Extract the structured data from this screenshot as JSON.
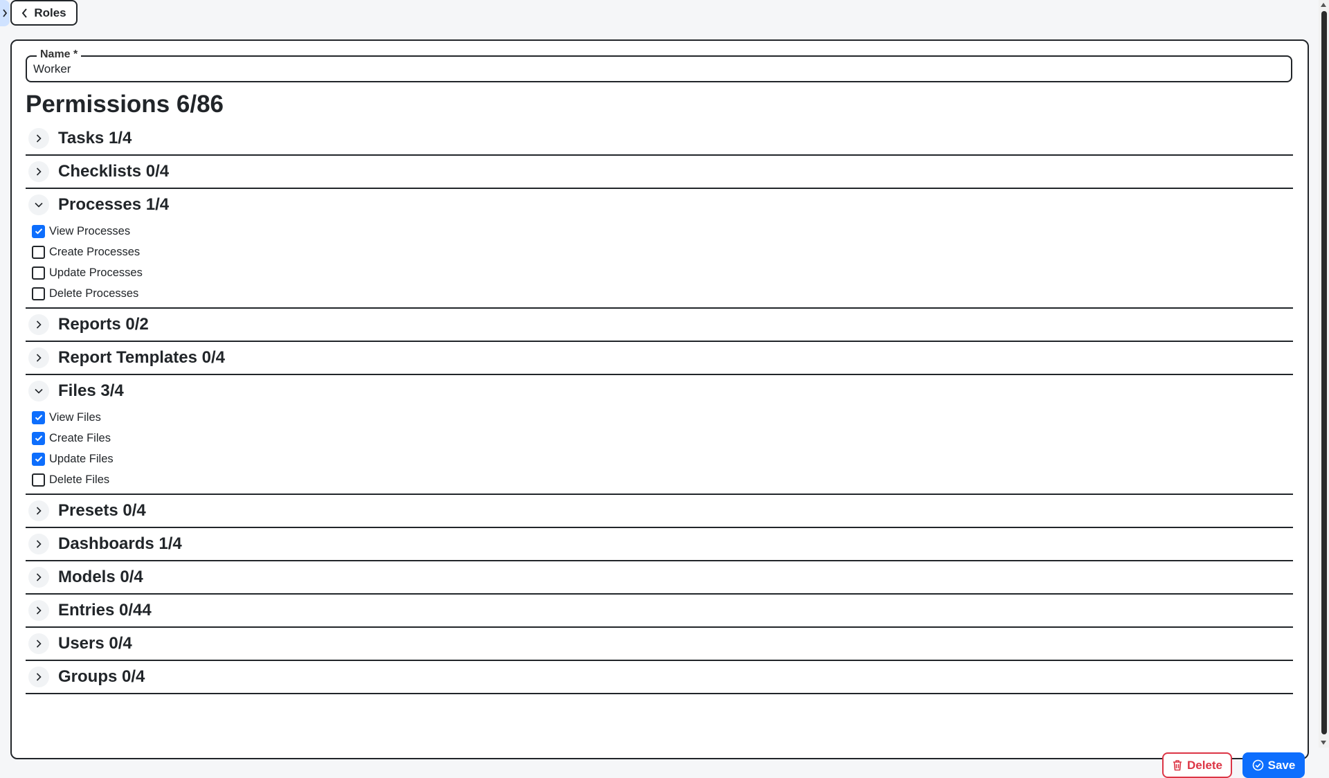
{
  "nav": {
    "back_label": "Roles"
  },
  "name_field": {
    "label": "Name *",
    "value": "Worker"
  },
  "permissions": {
    "title": "Permissions 6/86",
    "sections": [
      {
        "title": "Tasks 1/4",
        "expanded": false,
        "items": []
      },
      {
        "title": "Checklists 0/4",
        "expanded": false,
        "items": []
      },
      {
        "title": "Processes 1/4",
        "expanded": true,
        "items": [
          {
            "label": "View Processes",
            "checked": true
          },
          {
            "label": "Create Processes",
            "checked": false
          },
          {
            "label": "Update Processes",
            "checked": false
          },
          {
            "label": "Delete Processes",
            "checked": false
          }
        ]
      },
      {
        "title": "Reports 0/2",
        "expanded": false,
        "items": []
      },
      {
        "title": "Report Templates 0/4",
        "expanded": false,
        "items": []
      },
      {
        "title": "Files 3/4",
        "expanded": true,
        "items": [
          {
            "label": "View Files",
            "checked": true
          },
          {
            "label": "Create Files",
            "checked": true
          },
          {
            "label": "Update Files",
            "checked": true
          },
          {
            "label": "Delete Files",
            "checked": false
          }
        ]
      },
      {
        "title": "Presets 0/4",
        "expanded": false,
        "items": []
      },
      {
        "title": "Dashboards 1/4",
        "expanded": false,
        "items": []
      },
      {
        "title": "Models 0/4",
        "expanded": false,
        "items": []
      },
      {
        "title": "Entries 0/44",
        "expanded": false,
        "items": []
      },
      {
        "title": "Users 0/4",
        "expanded": false,
        "items": []
      },
      {
        "title": "Groups 0/4",
        "expanded": false,
        "items": []
      }
    ]
  },
  "actions": {
    "delete_label": "Delete",
    "save_label": "Save"
  },
  "colors": {
    "primary": "#0d6efd",
    "danger": "#dc3545",
    "text": "#212529",
    "page_bg": "#f5f6f8",
    "sidebar_toggle": "#cfe2ff"
  },
  "icons": {
    "sidebar_toggle": "chevron-right-icon",
    "back": "chevron-left-icon",
    "collapsed": "chevron-right-icon",
    "expanded": "chevron-down-icon",
    "delete": "trash-icon",
    "save": "check-circle-icon"
  }
}
